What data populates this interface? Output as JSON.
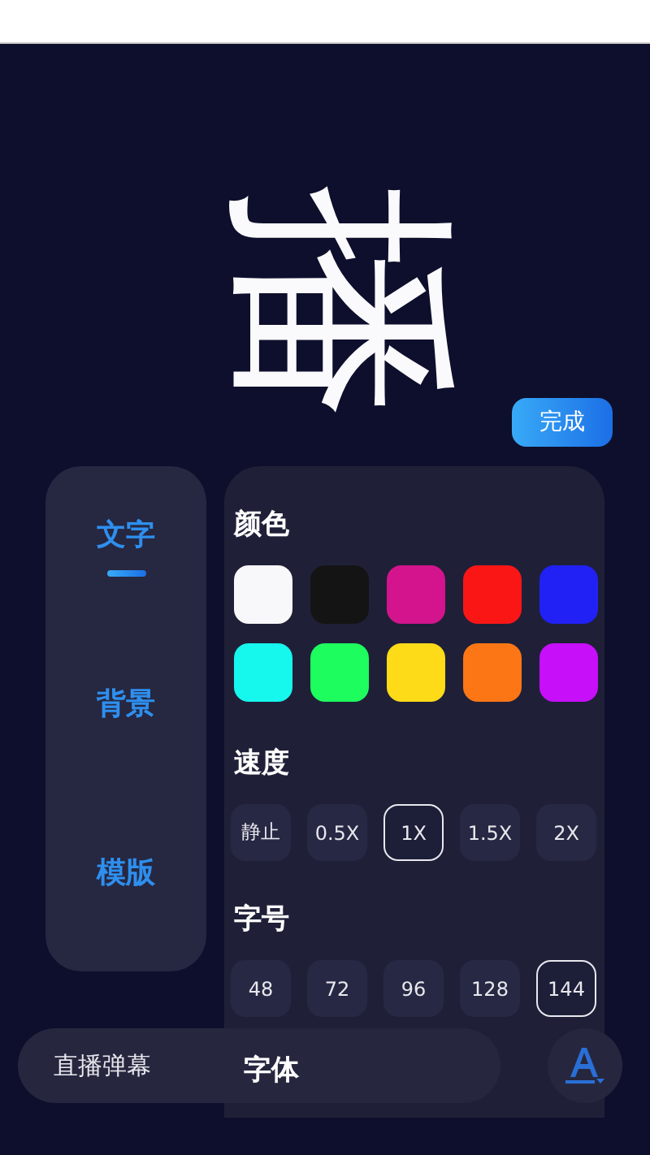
{
  "preview": {
    "text": "播"
  },
  "done_button": "完成",
  "tabs": [
    {
      "label": "文字",
      "selected": true
    },
    {
      "label": "背景",
      "selected": false
    },
    {
      "label": "模版",
      "selected": false
    }
  ],
  "color_section": {
    "title": "颜色",
    "swatches": [
      {
        "color": "#f8f8fa"
      },
      {
        "color": "#141414"
      },
      {
        "color": "#d3148c"
      },
      {
        "color": "#fb1616"
      },
      {
        "color": "#2121f5"
      },
      {
        "color": "#16f7ee"
      },
      {
        "color": "#1efd5e"
      },
      {
        "color": "#fedb18"
      },
      {
        "color": "#fd7616"
      },
      {
        "color": "#c70ffa"
      }
    ]
  },
  "speed_section": {
    "title": "速度",
    "options": [
      {
        "label": "静止",
        "selected": false
      },
      {
        "label": "0.5X",
        "selected": false
      },
      {
        "label": "1X",
        "selected": true
      },
      {
        "label": "1.5X",
        "selected": false
      },
      {
        "label": "2X",
        "selected": false
      }
    ]
  },
  "size_section": {
    "title": "字号",
    "options": [
      {
        "label": "48",
        "selected": false
      },
      {
        "label": "72",
        "selected": false
      },
      {
        "label": "96",
        "selected": false
      },
      {
        "label": "128",
        "selected": false
      },
      {
        "label": "144",
        "selected": true
      }
    ]
  },
  "font_section": {
    "title": "字体"
  },
  "input": {
    "value": "直播弹幕"
  }
}
